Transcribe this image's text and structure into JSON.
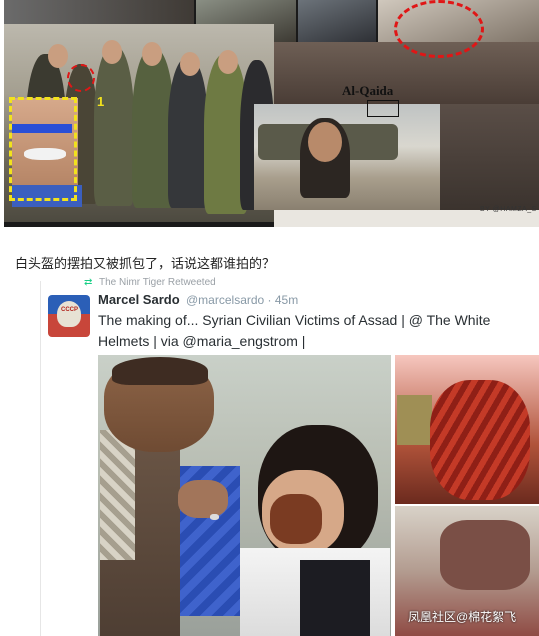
{
  "collage": {
    "annotation_label": "Al-Qaida",
    "marker_number": "1",
    "credit": "BY @HAMZA_S"
  },
  "caption": "白头盔的摆拍又被抓包了，话说这都谁拍的？",
  "tweet": {
    "retweeted_by": "The Nimr Tiger Retweeted",
    "author_name": "Marcel Sardo",
    "author_handle": "@marcelsardo · 45m",
    "avatar_text": "CCCP",
    "text": "The making of... Syrian Civilian Victims of Assad | @ The White Helmets | via @maria_engstrom |"
  },
  "watermark": "凤凰社区@棉花絮飞",
  "colors": {
    "highlight_yellow": "#f2e21d",
    "highlight_red": "#e01616",
    "retweet_green": "#19cf86"
  },
  "icons": [
    "retweet-icon"
  ]
}
